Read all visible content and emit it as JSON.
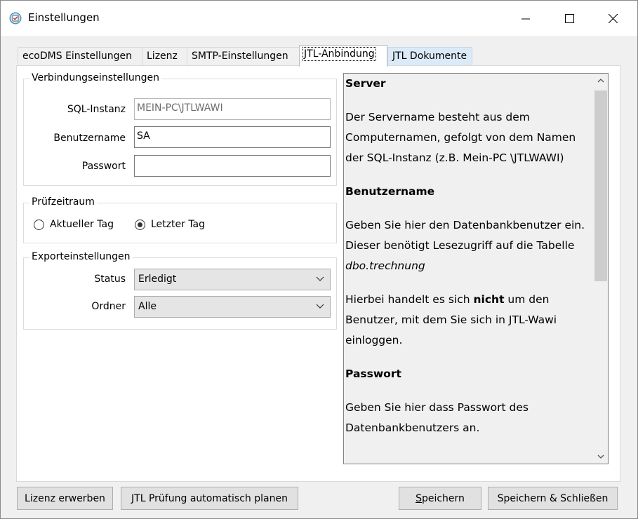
{
  "window": {
    "title": "Einstellungen",
    "controls": [
      "minimize",
      "maximize",
      "close"
    ]
  },
  "tabs": [
    {
      "label": "ecoDMS Einstellungen",
      "state": "normal"
    },
    {
      "label": "Lizenz",
      "state": "normal"
    },
    {
      "label": "SMTP-Einstellungen",
      "state": "normal"
    },
    {
      "label": "JTL-Anbindung",
      "state": "active"
    },
    {
      "label": "JTL Dokumente",
      "state": "hover"
    }
  ],
  "connection": {
    "legend": "Verbindungseinstellungen",
    "sql_label": "SQL-Instanz",
    "sql_value": "MEIN-PC\\JTLWAWI",
    "user_label": "Benutzername",
    "user_value": "SA",
    "password_label": "Passwort",
    "password_value": ""
  },
  "period": {
    "legend": "Prüfzeitraum",
    "options": [
      {
        "label": "Aktueller Tag",
        "checked": false
      },
      {
        "label": "Letzter Tag",
        "checked": true
      }
    ]
  },
  "export": {
    "legend": "Exporteinstellungen",
    "status_label": "Status",
    "status_value": "Erledigt",
    "folder_label": "Ordner",
    "folder_value": "Alle"
  },
  "help": {
    "server_heading": "Server",
    "server_text": "Der Servername besteht aus dem Computernamen, gefolgt von dem Namen der SQL-Instanz (z.B. Mein-PC \\JTLWAWI)",
    "user_heading": "Benutzername",
    "user_text_1": "Geben Sie hier den Datenbankbenutzer ein. Dieser benötigt Lesezugriff auf die Tabelle ",
    "user_text_table": "dbo.trechnung",
    "user_text_2a": "Hierbei handelt es sich ",
    "user_text_2b": "nicht",
    "user_text_2c": " um den Benutzer, mit dem Sie sich in JTL-Wawi einloggen.",
    "password_heading": "Passwort",
    "password_text": "Geben Sie hier dass Passwort des Datenbankbenutzers an."
  },
  "buttons": {
    "buy_license": "Lizenz erwerben",
    "schedule": "JTL Prüfung automatisch planen",
    "save_first": "S",
    "save_rest": "peichern",
    "save_close": "Speichern & Schließen"
  },
  "colors": {
    "window_bg": "#f0f0f0",
    "tab_hover": "#dceaf7",
    "button_bg": "#e1e1e1",
    "combo_bg": "#e5e5e5"
  }
}
